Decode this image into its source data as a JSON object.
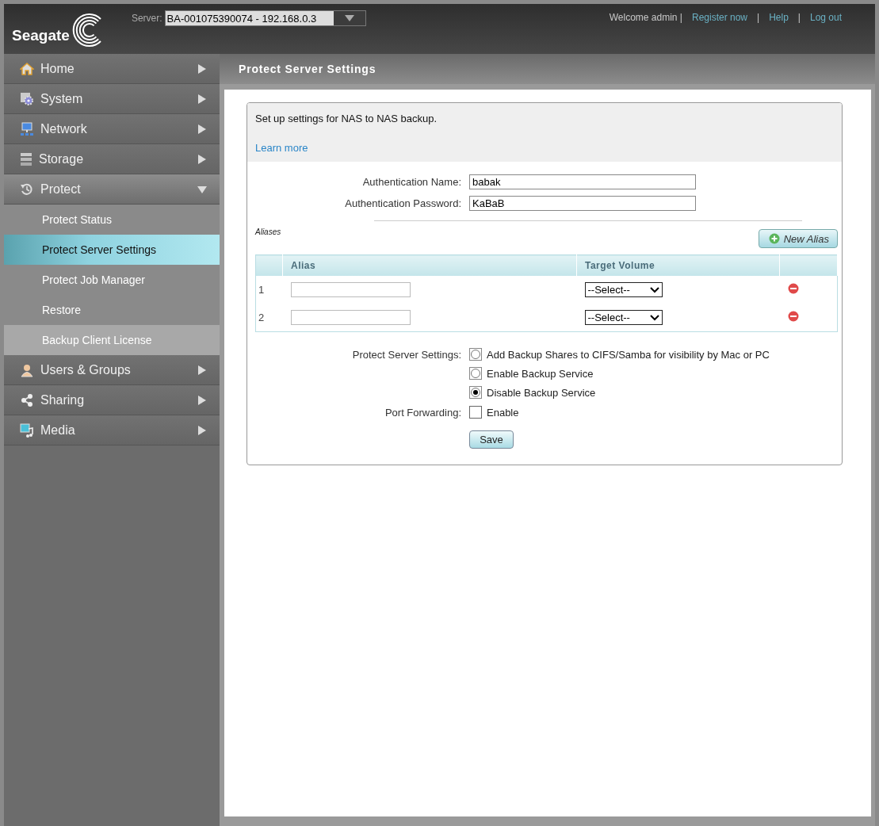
{
  "header": {
    "logo": "Seagate",
    "server_label": "Server:",
    "server_value": "BA-001075390074 - 192.168.0.3",
    "links": [
      {
        "kind": "text",
        "label": "Welcome admin |"
      },
      {
        "kind": "link",
        "label": "Register now"
      },
      {
        "kind": "text",
        "label": "|"
      },
      {
        "kind": "link",
        "label": "Help"
      },
      {
        "kind": "text",
        "label": "|"
      },
      {
        "kind": "link",
        "label": "Log out"
      }
    ]
  },
  "sidebar": {
    "items": [
      {
        "label": "Home",
        "expanded": false
      },
      {
        "label": "System",
        "expanded": false
      },
      {
        "label": "Network",
        "expanded": false
      },
      {
        "label": "Storage",
        "expanded": false
      },
      {
        "label": "Protect",
        "expanded": true,
        "children": [
          {
            "label": "Protect Status",
            "selected": false,
            "highlighted": false
          },
          {
            "label": "Protect Server Settings",
            "selected": true,
            "highlighted": false
          },
          {
            "label": "Protect Job Manager",
            "selected": false,
            "highlighted": false
          },
          {
            "label": "Restore",
            "selected": false,
            "highlighted": false
          },
          {
            "label": "Backup Client License",
            "selected": false,
            "highlighted": true
          }
        ]
      },
      {
        "label": "Users & Groups",
        "expanded": false
      },
      {
        "label": "Sharing",
        "expanded": false
      },
      {
        "label": "Media",
        "expanded": false
      }
    ]
  },
  "page": {
    "title": "Protect Server Settings",
    "intro": "Set up settings for NAS to NAS backup.",
    "learn_more": "Learn more",
    "auth_fields": [
      {
        "label": "Authentication Name:",
        "value": "babak"
      },
      {
        "label": "Authentication Password:",
        "value": "KaBaB"
      }
    ],
    "aliases_label": "Aliases",
    "new_alias_button": "New Alias",
    "table": {
      "columns": [
        "Alias",
        "Target Volume"
      ],
      "rows": [
        {
          "number": "1",
          "target": "--Select--"
        },
        {
          "number": "2",
          "target": "--Select--"
        }
      ]
    },
    "settings_label": "Protect Server Settings:",
    "options": [
      {
        "label": "Add Backup Shares to CIFS/Samba for visibility by Mac or PC",
        "selected": false
      },
      {
        "label": "Enable Backup Service",
        "selected": false
      },
      {
        "label": "Disable Backup Service",
        "selected": true
      }
    ],
    "port_forwarding": {
      "label": "Port Forwarding:",
      "option": "Enable",
      "checked": false
    },
    "save_button": "Save"
  }
}
